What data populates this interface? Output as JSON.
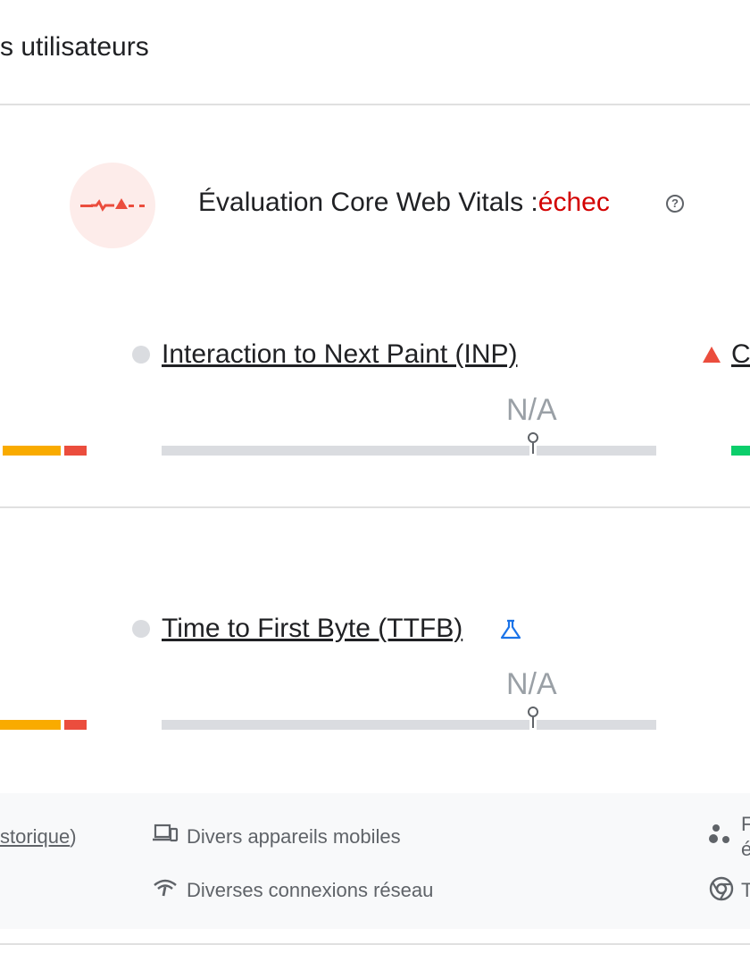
{
  "header": {
    "title": "s utilisateurs"
  },
  "assessment": {
    "label": "Évaluation Core Web Vitals :",
    "status": "échec",
    "help_glyph": "?",
    "status_color": "#d30000"
  },
  "metrics": [
    {
      "name": "Interaction to Next Paint (INP)",
      "value": "N/A",
      "status_icon": "gray-circle-icon"
    },
    {
      "name": "Time to First Byte (TTFB)",
      "value": "N/A",
      "status_icon": "gray-circle-icon",
      "badge_icon": "flask-icon"
    }
  ],
  "partial_metric": {
    "label": "C",
    "status_icon": "red-triangle-icon"
  },
  "footer": {
    "period_link": "storique",
    "period_close": ")",
    "devices": "Divers appareils mobiles",
    "network": "Diverses connexions réseau",
    "right_partial_1a": "F",
    "right_partial_1b": "é",
    "right_partial_2": "T"
  },
  "colors": {
    "good": "#0cce6b",
    "needs_improvement": "#f9ab00",
    "poor": "#eb4d3d",
    "no_data": "#dadce0",
    "accent_link": "#1a73e8"
  }
}
